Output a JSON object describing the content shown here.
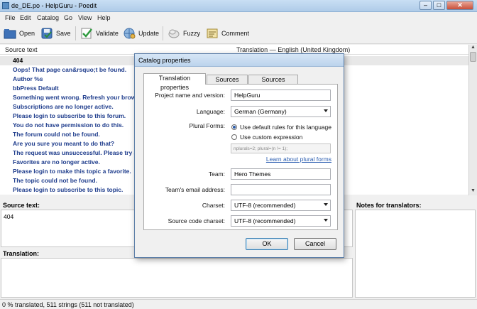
{
  "window": {
    "title": "de_DE.po - HelpGuru - Poedit",
    "minimize": "–",
    "maximize": "□",
    "close": "✕"
  },
  "menu": [
    "File",
    "Edit",
    "Catalog",
    "Go",
    "View",
    "Help"
  ],
  "toolbar": {
    "open": "Open",
    "save": "Save",
    "validate": "Validate",
    "update": "Update",
    "fuzzy": "Fuzzy",
    "comment": "Comment"
  },
  "list": {
    "col_source": "Source text",
    "col_translation": "Translation — English (United Kingdom)",
    "rows": [
      "404",
      "Oops! That page can&rsquo;t be found.",
      "Author %s",
      "bbPress Default",
      "Something went wrong. Refresh your brows",
      "Subscriptions are no longer active.",
      "Please login to subscribe to this forum.",
      "You do not have permission to do this.",
      "The forum could not be found.",
      "Are you sure you meant to do that?",
      "The request was unsuccessful. Please try again",
      "Favorites are no longer active.",
      "Please login to make this topic a favorite.",
      "The topic could not be found.",
      "Please login to subscribe to this topic."
    ]
  },
  "source_panel": {
    "label": "Source text:",
    "value": "404"
  },
  "translation_panel": {
    "label": "Translation:"
  },
  "notes_panel": {
    "label": "Notes for translators:"
  },
  "status": "0 % translated, 511 strings (511 not translated)",
  "dialog": {
    "title": "Catalog properties",
    "tabs": [
      "Translation properties",
      "Sources paths",
      "Sources keywords"
    ],
    "project_label": "Project name and version:",
    "project_value": "HelpGuru",
    "language_label": "Language:",
    "language_value": "German (Germany)",
    "plural_label": "Plural Forms:",
    "plural_default": "Use default rules for this language",
    "plural_custom": "Use custom expression",
    "plural_expr": "nplurals=2; plural=(n != 1);",
    "plural_link": "Learn about plural forms",
    "team_label": "Team:",
    "team_value": "Hero Themes",
    "email_label": "Team's email address:",
    "email_value": "",
    "charset_label": "Charset:",
    "charset_value": "UTF-8 (recommended)",
    "source_charset_label": "Source code charset:",
    "source_charset_value": "UTF-8 (recommended)",
    "ok": "OK",
    "cancel": "Cancel"
  }
}
